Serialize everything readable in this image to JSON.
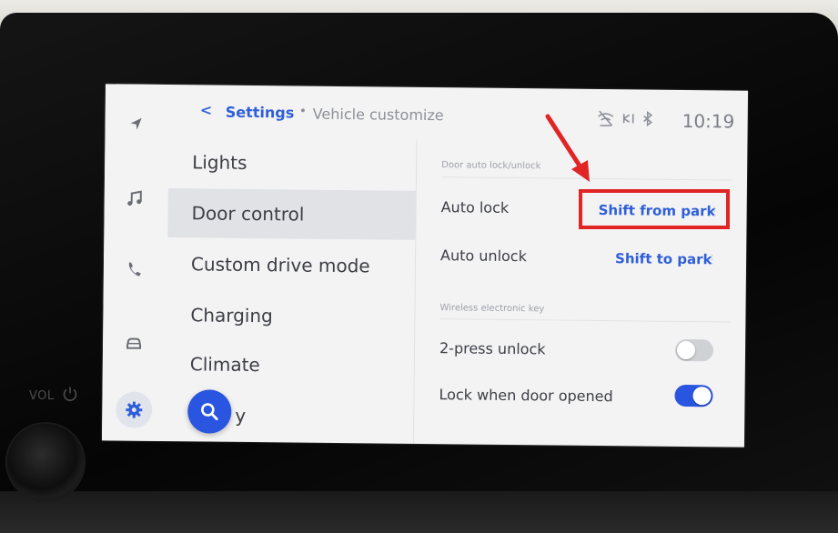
{
  "device": {
    "volume_label": "VOL"
  },
  "header": {
    "back_symbol": "<",
    "breadcrumb_root": "Settings",
    "breadcrumb_separator": "•",
    "breadcrumb_page": "Vehicle customize",
    "status_icons": [
      "no-signal-icon",
      "wifi-direct-icon",
      "bluetooth-icon"
    ],
    "clock": "10:19"
  },
  "rail": {
    "items": [
      "navigation-icon",
      "music-icon",
      "phone-icon",
      "car-icon",
      "settings-icon"
    ],
    "active": "settings-icon"
  },
  "menu": {
    "items": [
      {
        "label": "Lights",
        "active": false
      },
      {
        "label": "Door control",
        "active": true
      },
      {
        "label": "Custom drive mode",
        "active": false
      },
      {
        "label": "Charging",
        "active": false
      },
      {
        "label": "Climate",
        "active": false
      },
      {
        "label": "y",
        "active": false
      }
    ],
    "search_button_icon": "search-icon"
  },
  "detail": {
    "section1": {
      "title": "Door auto lock/unlock",
      "rows": [
        {
          "label": "Auto lock",
          "value": "Shift from park",
          "more": "⋮"
        },
        {
          "label": "Auto unlock",
          "value": "Shift to park",
          "more": "⋮"
        }
      ]
    },
    "section2": {
      "title": "Wireless electronic key",
      "rows": [
        {
          "label": "2-press unlock",
          "toggle": false
        },
        {
          "label": "Lock when door opened",
          "toggle": true
        }
      ]
    }
  },
  "colors": {
    "accent": "#2a55e0",
    "link": "#2f5fd8",
    "annotation": "#e12525",
    "screen_bg": "#f3f3f4",
    "active_menu_bg": "#e1e2e6"
  }
}
